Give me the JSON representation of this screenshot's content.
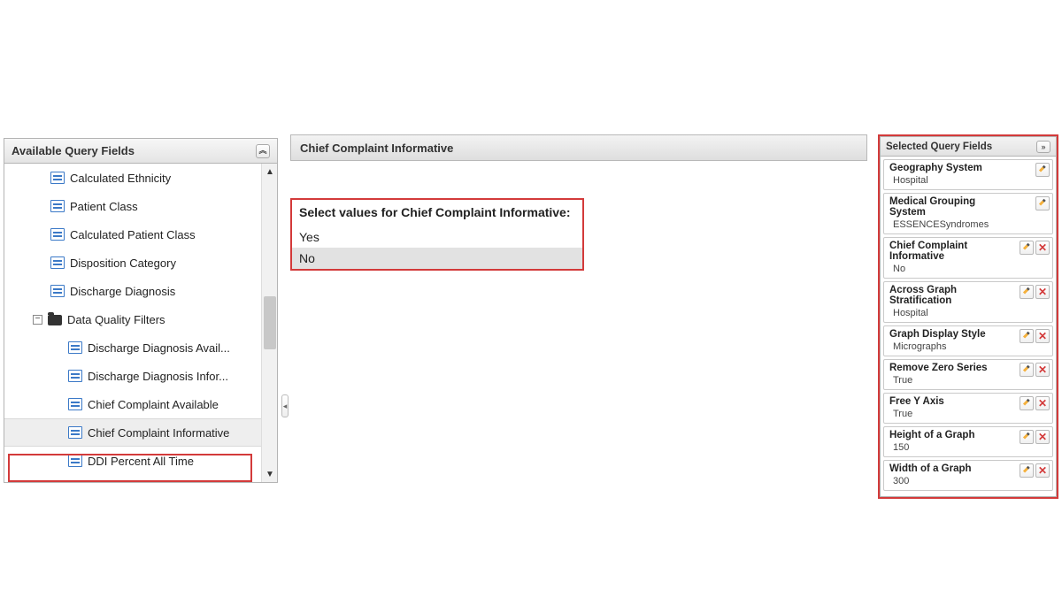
{
  "left_panel": {
    "title": "Available Query Fields",
    "nodes": [
      {
        "label": "Calculated Ethnicity",
        "type": "field",
        "indent": 1
      },
      {
        "label": "Patient Class",
        "type": "field",
        "indent": 1
      },
      {
        "label": "Calculated Patient Class",
        "type": "field",
        "indent": 1
      },
      {
        "label": "Disposition Category",
        "type": "field",
        "indent": 1
      },
      {
        "label": "Discharge Diagnosis",
        "type": "field",
        "indent": 1
      },
      {
        "label": "Data Quality Filters",
        "type": "folder",
        "indent": 1,
        "expanded": true
      },
      {
        "label": "Discharge Diagnosis Avail...",
        "type": "field",
        "indent": 2
      },
      {
        "label": "Discharge Diagnosis Infor...",
        "type": "field",
        "indent": 2
      },
      {
        "label": "Chief Complaint Available",
        "type": "field",
        "indent": 2
      },
      {
        "label": "Chief Complaint Informative",
        "type": "field",
        "indent": 2,
        "selected": true
      },
      {
        "label": "DDI Percent All Time",
        "type": "field",
        "indent": 2
      }
    ]
  },
  "center": {
    "title": "Chief Complaint Informative",
    "prompt": "Select values for Chief Complaint Informative:",
    "options": [
      "Yes",
      "No"
    ]
  },
  "right_panel": {
    "title": "Selected Query Fields",
    "items": [
      {
        "title": "Geography System",
        "value": "Hospital",
        "removable": false
      },
      {
        "title": "Medical Grouping System",
        "value": "ESSENCESyndromes",
        "removable": false
      },
      {
        "title": "Chief Complaint Informative",
        "value": "No",
        "removable": true
      },
      {
        "title": "Across Graph Stratification",
        "value": "Hospital",
        "removable": true
      },
      {
        "title": "Graph Display Style",
        "value": "Micrographs",
        "removable": true
      },
      {
        "title": "Remove Zero Series",
        "value": "True",
        "removable": true
      },
      {
        "title": "Free Y Axis",
        "value": "True",
        "removable": true
      },
      {
        "title": "Height of a Graph",
        "value": "150",
        "removable": true
      },
      {
        "title": "Width of a Graph",
        "value": "300",
        "removable": true
      }
    ]
  }
}
